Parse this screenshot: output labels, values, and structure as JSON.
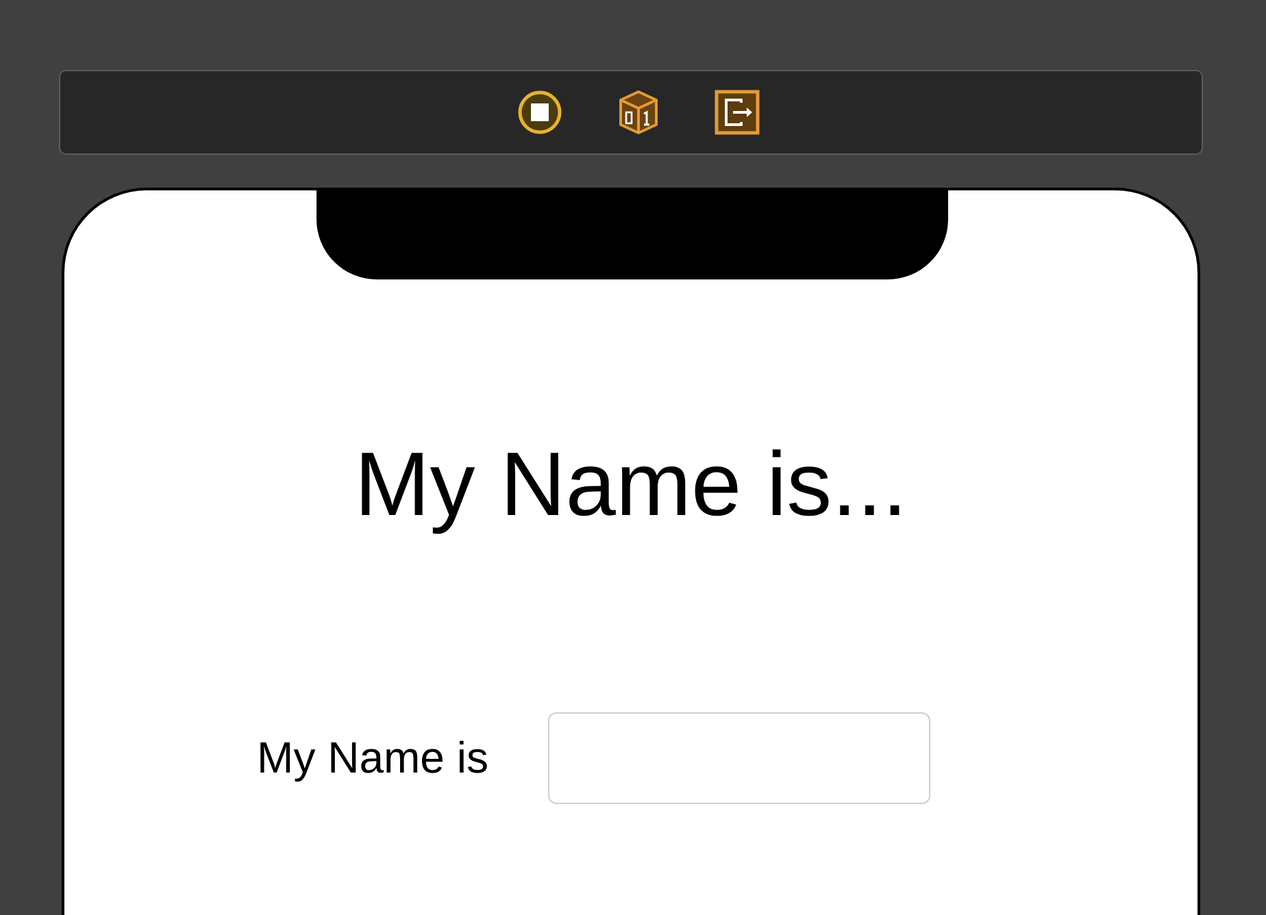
{
  "title": "My Name is...",
  "name_label": "My Name is"
}
